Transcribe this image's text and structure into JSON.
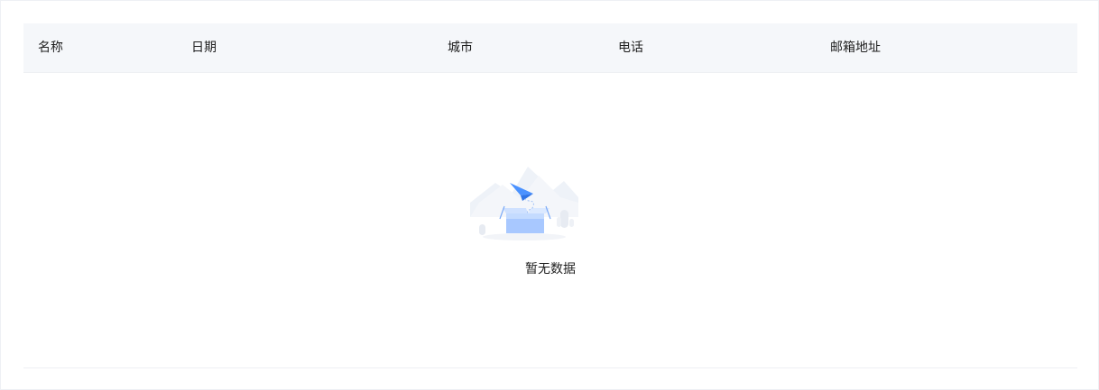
{
  "table": {
    "columns": [
      {
        "label": "名称"
      },
      {
        "label": "日期"
      },
      {
        "label": "城市"
      },
      {
        "label": "电话"
      },
      {
        "label": "邮箱地址"
      }
    ],
    "rows": [],
    "empty_text": "暂无数据"
  },
  "colors": {
    "header_bg": "#f5f7fa",
    "accent": "#4b92ff",
    "text": "#1f1f1f"
  },
  "icons": {
    "empty_state": "empty-box-paper-plane-illustration"
  }
}
